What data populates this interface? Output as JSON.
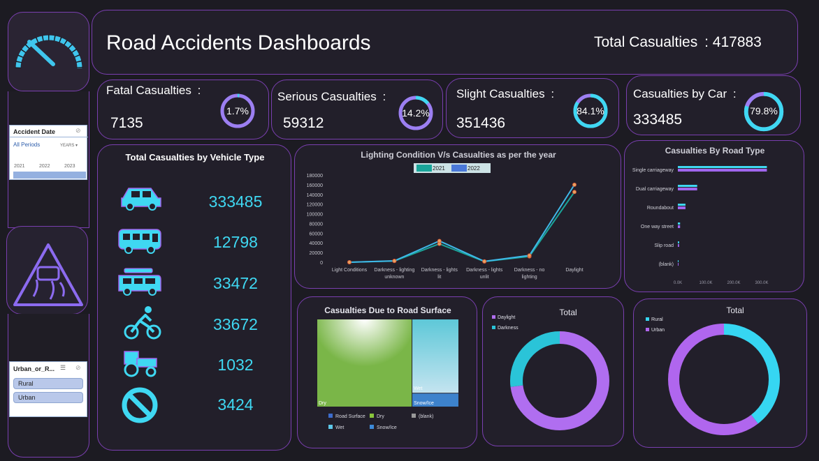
{
  "header": {
    "title": "Road Accidents Dashboards",
    "total_label": "Total Casualties",
    "total_sep": ":",
    "total_value": "417883"
  },
  "kpis": [
    {
      "label": "Fatal Casualties",
      "sep": ":",
      "value": "7135",
      "pct": "1.7%",
      "fraction": 0.017
    },
    {
      "label": "Serious Casualties",
      "sep": ":",
      "value": "59312",
      "pct": "14.2%",
      "fraction": 0.142
    },
    {
      "label": "Slight Casualties",
      "sep": ":",
      "value": "351436",
      "pct": "84.1%",
      "fraction": 0.841
    },
    {
      "label": "Casualties by Car",
      "sep": ":",
      "value": "333485",
      "pct": "79.8%",
      "fraction": 0.798
    }
  ],
  "slicer_date": {
    "title": "Accident Date",
    "periods": "All Periods",
    "unit": "YEARS",
    "years": [
      "2021",
      "2022",
      "2023"
    ]
  },
  "slicer_area": {
    "title": "Urban_or_R...",
    "items": [
      "Rural",
      "Urban"
    ]
  },
  "vehicles": {
    "title": "Total Casualties by Vehicle Type",
    "items": [
      {
        "icon": "car-icon",
        "value": "333485"
      },
      {
        "icon": "bus-icon",
        "value": "12798"
      },
      {
        "icon": "van-icon",
        "value": "33472"
      },
      {
        "icon": "bicycle-icon",
        "value": "33672"
      },
      {
        "icon": "tractor-icon",
        "value": "1032"
      },
      {
        "icon": "prohibited-icon",
        "value": "3424"
      }
    ]
  },
  "colors": {
    "accent": "#7a3fb0",
    "cyan": "#3fd8f2",
    "purple": "#a066ee",
    "teal": "#1aa59a",
    "blue": "#4a78d8"
  },
  "chart_data": [
    {
      "type": "line",
      "title": "Lighting Condition V/s Casualties as per the year",
      "categories": [
        "Light Conditions",
        "Darkness - lighting unknown",
        "Darkness - lights lit",
        "Darkness - lights unlit",
        "Darkness - no lighting",
        "Daylight"
      ],
      "series": [
        {
          "name": "2021",
          "values": [
            0,
            2500,
            38000,
            1500,
            12000,
            145000
          ]
        },
        {
          "name": "2022",
          "values": [
            0,
            2800,
            44000,
            1800,
            14000,
            160000
          ]
        }
      ],
      "ylim": [
        0,
        180000
      ],
      "yticks": [
        "0",
        "20000",
        "40000",
        "60000",
        "80000",
        "100000",
        "120000",
        "140000",
        "160000",
        "180000"
      ],
      "legend": "top"
    },
    {
      "type": "bar",
      "title": "Casualties By Road Type",
      "orientation": "horizontal",
      "categories": [
        "Single carriageway",
        "Dual carriageway",
        "Roundabout",
        "One way street",
        "Slip road",
        "(blank)"
      ],
      "series": [
        {
          "values": [
            309698,
            67263,
            26537,
            7851,
            4452,
            200
          ]
        },
        {
          "values": [
            309698,
            67263,
            26537,
            7851,
            4452,
            200
          ]
        }
      ],
      "xticks": [
        "0.0K",
        "100.0K",
        "200.0K",
        "300.0K"
      ],
      "xlim": [
        0,
        350000
      ]
    },
    {
      "type": "heatmap",
      "title": "Casualties Due to Road Surface",
      "tiles": [
        {
          "label": "Dry",
          "value": 279445
        },
        {
          "label": "Wet",
          "value": 116564
        },
        {
          "label": "Snow/Ice",
          "value": 21874
        }
      ],
      "legend_items": [
        "Road Surface",
        "Dry",
        "(blank)",
        "Wet",
        "Snow/Ice"
      ]
    },
    {
      "type": "pie",
      "title": "Total",
      "labels": [
        "Daylight",
        "Darkness"
      ],
      "values": [
        305034,
        112849
      ]
    },
    {
      "type": "pie",
      "title": "Total",
      "labels": [
        "Rural",
        "Urban"
      ],
      "values": [
        165321,
        252562
      ]
    }
  ]
}
